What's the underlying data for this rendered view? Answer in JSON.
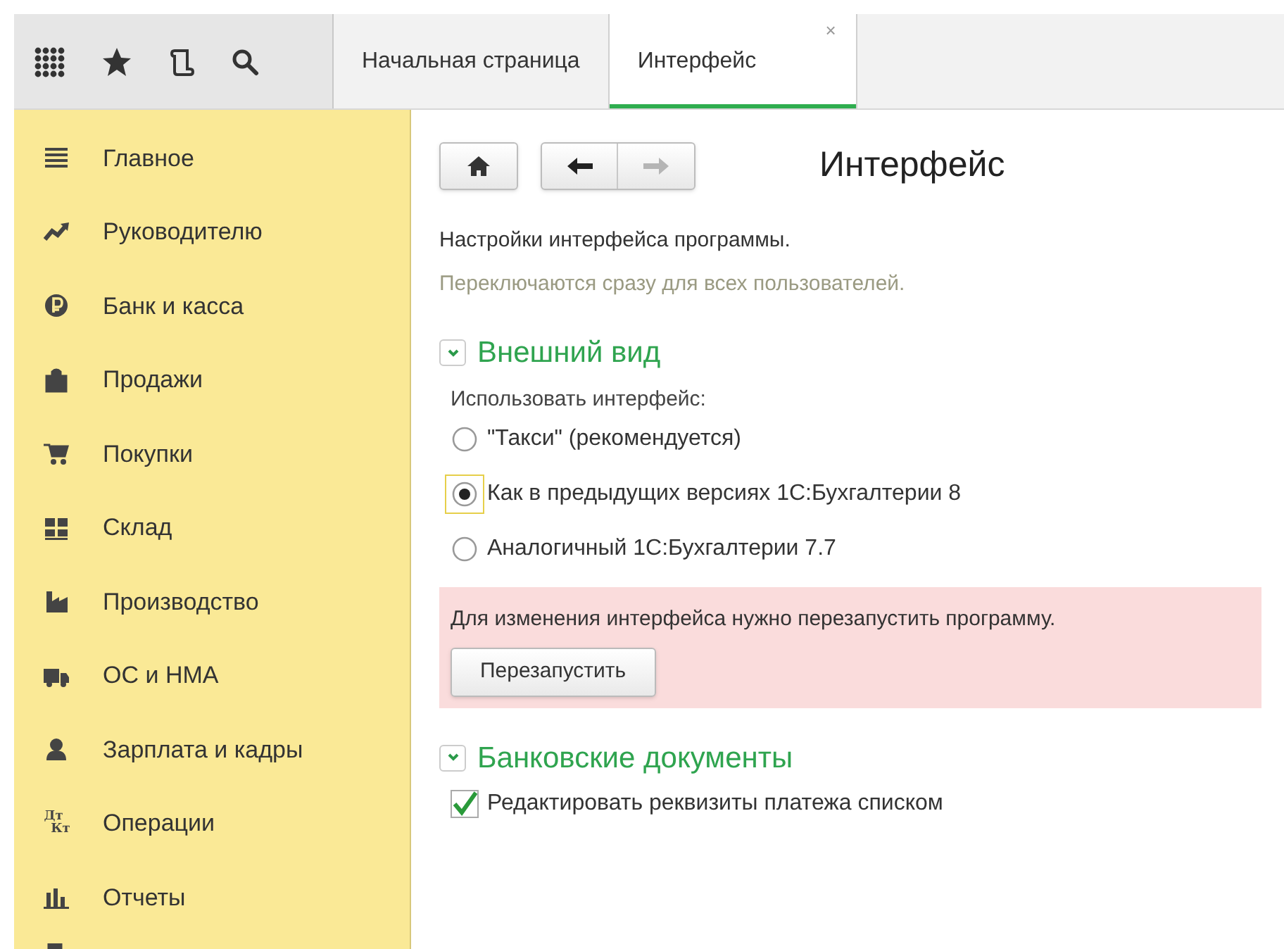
{
  "tabs": [
    {
      "label": "Начальная страница",
      "selected": false
    },
    {
      "label": "Интерфейс",
      "selected": true,
      "close": "×"
    }
  ],
  "sidebar": {
    "items": [
      {
        "label": "Главное"
      },
      {
        "label": "Руководителю"
      },
      {
        "label": "Банк и касса"
      },
      {
        "label": "Продажи"
      },
      {
        "label": "Покупки"
      },
      {
        "label": "Склад"
      },
      {
        "label": "Производство"
      },
      {
        "label": "ОС и НМА"
      },
      {
        "label": "Зарплата и кадры"
      },
      {
        "label": "Операции",
        "icon_text": [
          "Дт",
          "Кт"
        ]
      },
      {
        "label": "Отчеты"
      }
    ]
  },
  "page": {
    "title": "Интерфейс",
    "nav": {
      "back_disabled": false,
      "forward_disabled": true
    },
    "description": "Настройки интерфейса программы.",
    "note": "Переключаются сразу для всех пользователей.",
    "sections": [
      {
        "title": "Внешний вид",
        "expanded": true,
        "kind": "radio",
        "label": "Использовать интерфейс:",
        "options": [
          {
            "label": "\"Такси\" (рекомендуется)",
            "selected": false
          },
          {
            "label": "Как в предыдущих версиях 1С:Бухгалтерии 8",
            "selected": true
          },
          {
            "label": "Аналогичный 1С:Бухгалтерии 7.7",
            "selected": false
          }
        ],
        "warning": {
          "text": "Для изменения интерфейса нужно перезапустить программу.",
          "button": "Перезапустить"
        }
      },
      {
        "title": "Банковские документы",
        "expanded": true,
        "kind": "checkbox",
        "options": [
          {
            "label": "Редактировать реквизиты платежа списком",
            "checked": true
          }
        ]
      }
    ]
  }
}
